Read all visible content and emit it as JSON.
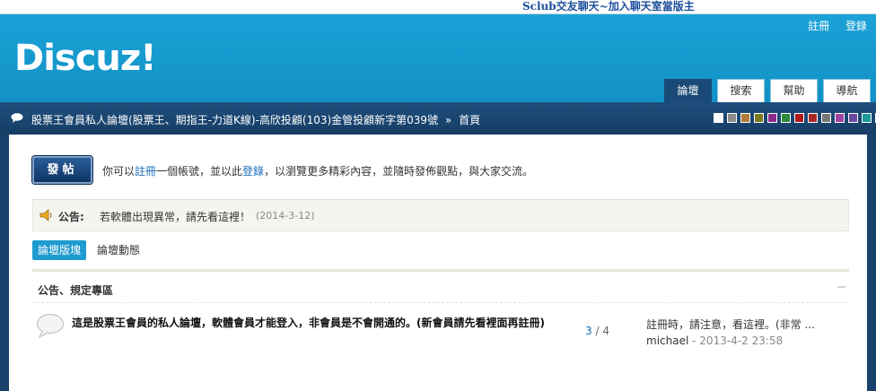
{
  "topbar": {
    "banner_text": "Sclub交友聊天~加入聊天室當版主"
  },
  "header": {
    "logo": "Discuz!",
    "user_links": {
      "register": "註冊",
      "login": "登錄"
    },
    "tabs": [
      {
        "label": "論壇",
        "active": true
      },
      {
        "label": "搜索",
        "active": false
      },
      {
        "label": "幫助",
        "active": false
      },
      {
        "label": "導航",
        "active": false
      }
    ]
  },
  "navbar": {
    "breadcrumb": {
      "forum": "股票王會員私人論壇(股票王、期指王-力道K線)-高欣投顧(103)金管投顧新字第039號",
      "separator": "»",
      "current": "首頁"
    },
    "swatches": [
      "#ffffff",
      "#8c8c8c",
      "#b07a3a",
      "#7a7a20",
      "#8a2a8a",
      "#2f8a3a",
      "#b01a1a",
      "#aa2a2a",
      "#777777",
      "#a040a0",
      "#6a4aa0",
      "#1a9a9a",
      "#3ab0b0"
    ]
  },
  "intro": {
    "post_button": "發帖",
    "text_before": "你可以",
    "register_link": "註冊",
    "text_middle": "一個帳號，並以此",
    "login_link": "登錄",
    "text_after": "，以瀏覽更多精彩內容，並隨時發佈觀點，與大家交流。"
  },
  "announcement": {
    "label": "公告:",
    "text": "若軟體出現異常，請先看這裡！",
    "date": "(2014-3-12)"
  },
  "forum_tabs": [
    {
      "label": "論壇版塊",
      "active": true
    },
    {
      "label": "論壇動態",
      "active": false
    }
  ],
  "section": {
    "title": "公告、規定專區",
    "forums": [
      {
        "title": "這是股票王會員的私人論壇，軟體會員才能登入，非會員是不會開通的。(新會員請先看裡面再註冊)",
        "threads": "3",
        "stats_sep": "/",
        "posts": "4",
        "last_post_title": "註冊時，請注意，看這裡。(非常 ...",
        "last_post_author": "michael",
        "last_post_sep": "-",
        "last_post_date": "2013-4-2 23:58"
      }
    ]
  }
}
